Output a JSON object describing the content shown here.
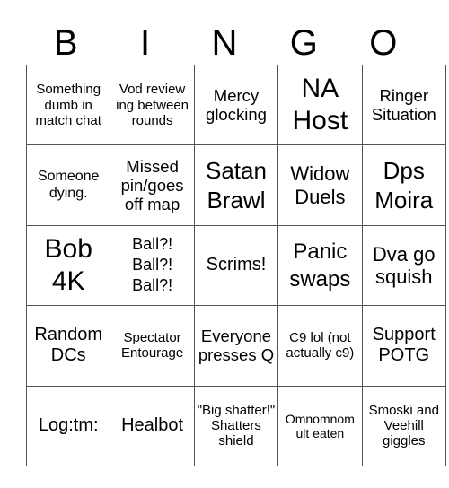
{
  "header": {
    "letters": [
      "B",
      "I",
      "N",
      "G",
      "O"
    ]
  },
  "grid": {
    "rows": [
      [
        "Something dumb in match chat",
        "Vod review ing between rounds",
        "Mercy glocking",
        "NA Host",
        "Ringer Situation"
      ],
      [
        "Someone dying.",
        "Missed pin/goes off map",
        "Satan Brawl",
        "Widow Duels",
        "Dps Moira"
      ],
      [
        "Bob 4K",
        "Ball?! Ball?! Ball?!",
        "Scrims!",
        "Panic swaps",
        "Dva go squish"
      ],
      [
        "Random DCs",
        "Spectator Entourage",
        "Everyone presses Q",
        "C9 lol (not actually c9)",
        "Support POTG"
      ],
      [
        "Log:tm:",
        "Healbot",
        "\"Big shatter!\" Shatters shield",
        "Omnomnom ult eaten",
        "Smoski and Veehill giggles"
      ]
    ]
  }
}
